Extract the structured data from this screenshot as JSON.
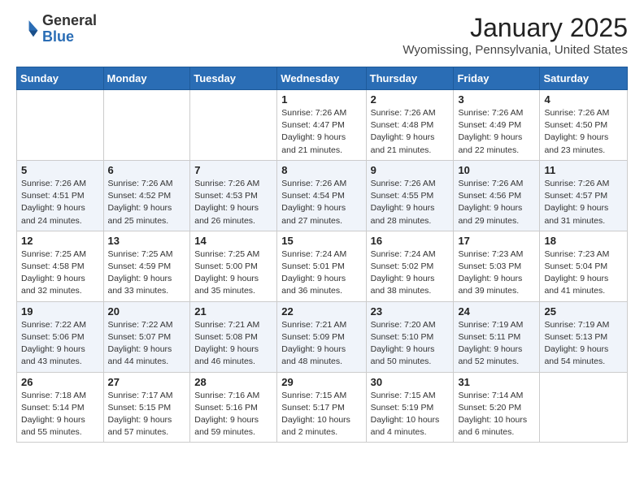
{
  "header": {
    "logo_general": "General",
    "logo_blue": "Blue",
    "month_title": "January 2025",
    "subtitle": "Wyomissing, Pennsylvania, United States"
  },
  "weekdays": [
    "Sunday",
    "Monday",
    "Tuesday",
    "Wednesday",
    "Thursday",
    "Friday",
    "Saturday"
  ],
  "weeks": [
    [
      {
        "day": "",
        "info": ""
      },
      {
        "day": "",
        "info": ""
      },
      {
        "day": "",
        "info": ""
      },
      {
        "day": "1",
        "info": "Sunrise: 7:26 AM\nSunset: 4:47 PM\nDaylight: 9 hours\nand 21 minutes."
      },
      {
        "day": "2",
        "info": "Sunrise: 7:26 AM\nSunset: 4:48 PM\nDaylight: 9 hours\nand 21 minutes."
      },
      {
        "day": "3",
        "info": "Sunrise: 7:26 AM\nSunset: 4:49 PM\nDaylight: 9 hours\nand 22 minutes."
      },
      {
        "day": "4",
        "info": "Sunrise: 7:26 AM\nSunset: 4:50 PM\nDaylight: 9 hours\nand 23 minutes."
      }
    ],
    [
      {
        "day": "5",
        "info": "Sunrise: 7:26 AM\nSunset: 4:51 PM\nDaylight: 9 hours\nand 24 minutes."
      },
      {
        "day": "6",
        "info": "Sunrise: 7:26 AM\nSunset: 4:52 PM\nDaylight: 9 hours\nand 25 minutes."
      },
      {
        "day": "7",
        "info": "Sunrise: 7:26 AM\nSunset: 4:53 PM\nDaylight: 9 hours\nand 26 minutes."
      },
      {
        "day": "8",
        "info": "Sunrise: 7:26 AM\nSunset: 4:54 PM\nDaylight: 9 hours\nand 27 minutes."
      },
      {
        "day": "9",
        "info": "Sunrise: 7:26 AM\nSunset: 4:55 PM\nDaylight: 9 hours\nand 28 minutes."
      },
      {
        "day": "10",
        "info": "Sunrise: 7:26 AM\nSunset: 4:56 PM\nDaylight: 9 hours\nand 29 minutes."
      },
      {
        "day": "11",
        "info": "Sunrise: 7:26 AM\nSunset: 4:57 PM\nDaylight: 9 hours\nand 31 minutes."
      }
    ],
    [
      {
        "day": "12",
        "info": "Sunrise: 7:25 AM\nSunset: 4:58 PM\nDaylight: 9 hours\nand 32 minutes."
      },
      {
        "day": "13",
        "info": "Sunrise: 7:25 AM\nSunset: 4:59 PM\nDaylight: 9 hours\nand 33 minutes."
      },
      {
        "day": "14",
        "info": "Sunrise: 7:25 AM\nSunset: 5:00 PM\nDaylight: 9 hours\nand 35 minutes."
      },
      {
        "day": "15",
        "info": "Sunrise: 7:24 AM\nSunset: 5:01 PM\nDaylight: 9 hours\nand 36 minutes."
      },
      {
        "day": "16",
        "info": "Sunrise: 7:24 AM\nSunset: 5:02 PM\nDaylight: 9 hours\nand 38 minutes."
      },
      {
        "day": "17",
        "info": "Sunrise: 7:23 AM\nSunset: 5:03 PM\nDaylight: 9 hours\nand 39 minutes."
      },
      {
        "day": "18",
        "info": "Sunrise: 7:23 AM\nSunset: 5:04 PM\nDaylight: 9 hours\nand 41 minutes."
      }
    ],
    [
      {
        "day": "19",
        "info": "Sunrise: 7:22 AM\nSunset: 5:06 PM\nDaylight: 9 hours\nand 43 minutes."
      },
      {
        "day": "20",
        "info": "Sunrise: 7:22 AM\nSunset: 5:07 PM\nDaylight: 9 hours\nand 44 minutes."
      },
      {
        "day": "21",
        "info": "Sunrise: 7:21 AM\nSunset: 5:08 PM\nDaylight: 9 hours\nand 46 minutes."
      },
      {
        "day": "22",
        "info": "Sunrise: 7:21 AM\nSunset: 5:09 PM\nDaylight: 9 hours\nand 48 minutes."
      },
      {
        "day": "23",
        "info": "Sunrise: 7:20 AM\nSunset: 5:10 PM\nDaylight: 9 hours\nand 50 minutes."
      },
      {
        "day": "24",
        "info": "Sunrise: 7:19 AM\nSunset: 5:11 PM\nDaylight: 9 hours\nand 52 minutes."
      },
      {
        "day": "25",
        "info": "Sunrise: 7:19 AM\nSunset: 5:13 PM\nDaylight: 9 hours\nand 54 minutes."
      }
    ],
    [
      {
        "day": "26",
        "info": "Sunrise: 7:18 AM\nSunset: 5:14 PM\nDaylight: 9 hours\nand 55 minutes."
      },
      {
        "day": "27",
        "info": "Sunrise: 7:17 AM\nSunset: 5:15 PM\nDaylight: 9 hours\nand 57 minutes."
      },
      {
        "day": "28",
        "info": "Sunrise: 7:16 AM\nSunset: 5:16 PM\nDaylight: 9 hours\nand 59 minutes."
      },
      {
        "day": "29",
        "info": "Sunrise: 7:15 AM\nSunset: 5:17 PM\nDaylight: 10 hours\nand 2 minutes."
      },
      {
        "day": "30",
        "info": "Sunrise: 7:15 AM\nSunset: 5:19 PM\nDaylight: 10 hours\nand 4 minutes."
      },
      {
        "day": "31",
        "info": "Sunrise: 7:14 AM\nSunset: 5:20 PM\nDaylight: 10 hours\nand 6 minutes."
      },
      {
        "day": "",
        "info": ""
      }
    ]
  ]
}
